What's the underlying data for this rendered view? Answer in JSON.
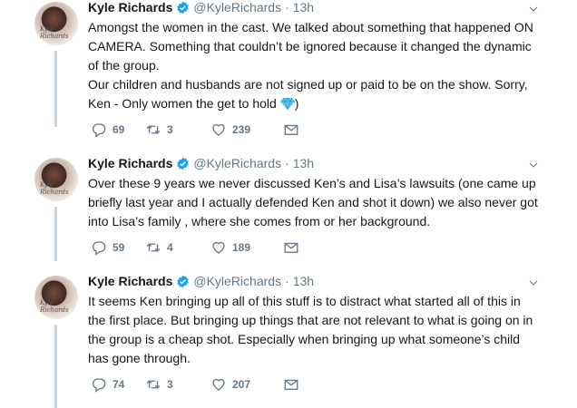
{
  "tweets": [
    {
      "name": "Kyle Richards",
      "handle": "@KyleRichards",
      "time": "13h",
      "text_parts": [
        "Amongst the women in the cast. We talked about something that happened ON\nCAMERA. Something that couldn’t be ignored because it changed the dynamic\nof the group.\nOur children and husbands are not signed up or paid to be on the show. Sorry,\nKen - Only women the get to hold ",
        ")"
      ],
      "emoji": "gem-stone",
      "replies": "69",
      "retweets": "3",
      "likes": "239"
    },
    {
      "name": "Kyle Richards",
      "handle": "@KyleRichards",
      "time": "13h",
      "text": "Over these 9 years we never discussed Ken’s and Lisa’s lawsuits (one came up\nbriefly last year and I actually defended Ken and shot it down) we also never got\ninto Lisa’s family , where she comes from or her background.",
      "replies": "59",
      "retweets": "4",
      "likes": "189"
    },
    {
      "name": "Kyle Richards",
      "handle": "@KyleRichards",
      "time": "13h",
      "text": "It seems Ken bringing up all of this stuff is to distract what started all of this in\nthe first place. But bringing up things that are not relevant to what is going on in\nthe group is a cheap shot. Especially when bringing up what someone’s child\nhas gone through.",
      "replies": "74",
      "retweets": "3",
      "likes": "207"
    }
  ],
  "colors": {
    "text": "#14171a",
    "secondary": "#657786",
    "verified": "#1da1f2",
    "thread_line": "#ccd6dd"
  },
  "icons": [
    "reply-icon",
    "retweet-icon",
    "like-icon",
    "direct-message-icon",
    "verified-badge-icon",
    "chevron-down-icon"
  ]
}
